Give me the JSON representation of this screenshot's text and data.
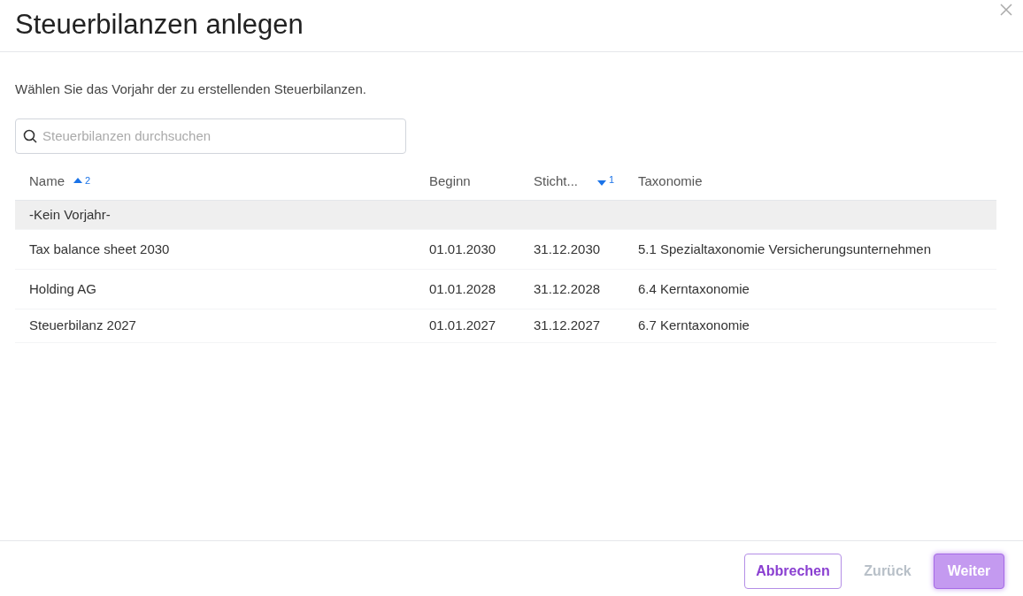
{
  "dialog": {
    "title": "Steuerbilanzen anlegen",
    "instruction": "Wählen Sie das Vorjahr der zu erstellenden Steuerbilanzen."
  },
  "search": {
    "placeholder": "Steuerbilanzen durchsuchen"
  },
  "table": {
    "columns": [
      {
        "label": "Name",
        "sorted_ascending": true,
        "sorted_descending": false,
        "sort_order": "2"
      },
      {
        "label": "Beginn",
        "sorted_ascending": false,
        "sorted_descending": false
      },
      {
        "label": "Sticht...",
        "sorted_ascending": false,
        "sorted_descending": true,
        "sort_order": "1"
      },
      {
        "label": "Taxonomie",
        "sorted_ascending": false,
        "sorted_descending": false
      }
    ],
    "rows": [
      {
        "cells": [
          "-Kein Vorjahr-"
        ],
        "selected": true
      },
      {
        "cells": [
          "Tax balance sheet 2030",
          "01.01.2030",
          "31.12.2030",
          "5.1 Spezialtaxonomie Versicherungsunternehmen"
        ],
        "selected": false
      },
      {
        "cells": [
          "Holding AG",
          "01.01.2028",
          "31.12.2028",
          "6.4 Kerntaxonomie"
        ],
        "selected": false
      },
      {
        "cells": [
          "Steuerbilanz 2027",
          "01.01.2027",
          "31.12.2027",
          "6.7 Kerntaxonomie"
        ],
        "selected": false
      }
    ]
  },
  "buttons": [
    {
      "label": "Abbrechen",
      "kind": "outline",
      "disabled": false
    },
    {
      "label": "Zurück",
      "kind": "text",
      "disabled": true
    },
    {
      "label": "Weiter",
      "kind": "primary",
      "disabled": false
    }
  ]
}
